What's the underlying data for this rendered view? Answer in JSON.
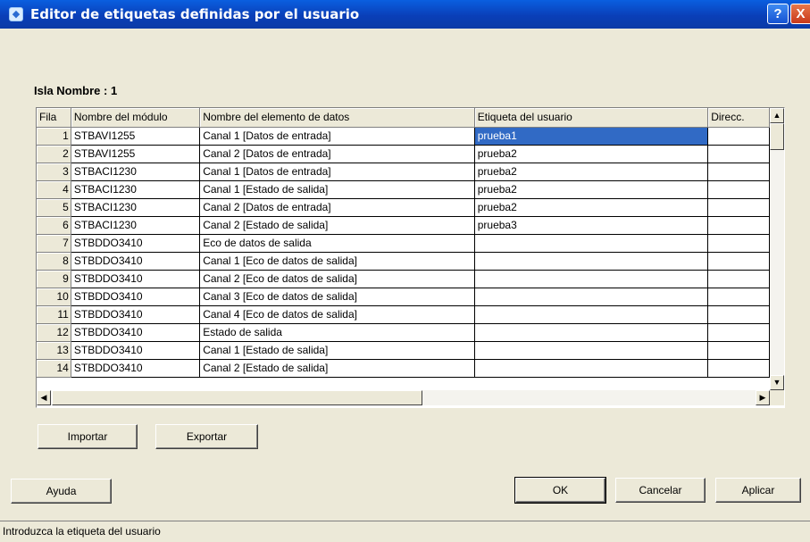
{
  "window": {
    "title": "Editor de etiquetas definidas por el usuario",
    "help_glyph": "?",
    "close_glyph": "X"
  },
  "island": {
    "label": "Isla Nombre : ",
    "value": "1"
  },
  "grid": {
    "columns": [
      "Fila",
      "Nombre del módulo",
      "Nombre del elemento de datos",
      "Etiqueta del usuario",
      "Direcc."
    ],
    "rows": [
      {
        "num": "1",
        "module": "STBAVI1255",
        "element": "Canal 1 [Datos de entrada]",
        "label": "prueba1",
        "addr": ""
      },
      {
        "num": "2",
        "module": "STBAVI1255",
        "element": "Canal 2 [Datos de entrada]",
        "label": "prueba2",
        "addr": ""
      },
      {
        "num": "3",
        "module": "STBACI1230",
        "element": "Canal 1 [Datos de entrada]",
        "label": "prueba2",
        "addr": ""
      },
      {
        "num": "4",
        "module": "STBACI1230",
        "element": "Canal 1 [Estado de salida]",
        "label": "prueba2",
        "addr": ""
      },
      {
        "num": "5",
        "module": "STBACI1230",
        "element": "Canal 2 [Datos de entrada]",
        "label": "prueba2",
        "addr": ""
      },
      {
        "num": "6",
        "module": "STBACI1230",
        "element": "Canal 2 [Estado de salida]",
        "label": "prueba3",
        "addr": ""
      },
      {
        "num": "7",
        "module": "STBDDO3410",
        "element": "Eco de datos de salida",
        "label": "",
        "addr": ""
      },
      {
        "num": "8",
        "module": "STBDDO3410",
        "element": "Canal 1 [Eco de datos de salida]",
        "label": "",
        "addr": ""
      },
      {
        "num": "9",
        "module": "STBDDO3410",
        "element": "Canal 2 [Eco de datos de salida]",
        "label": "",
        "addr": ""
      },
      {
        "num": "10",
        "module": "STBDDO3410",
        "element": "Canal 3 [Eco de datos de salida]",
        "label": "",
        "addr": ""
      },
      {
        "num": "11",
        "module": "STBDDO3410",
        "element": "Canal 4 [Eco de datos de salida]",
        "label": "",
        "addr": ""
      },
      {
        "num": "12",
        "module": "STBDDO3410",
        "element": "Estado de salida",
        "label": "",
        "addr": ""
      },
      {
        "num": "13",
        "module": "STBDDO3410",
        "element": "Canal 1 [Estado de salida]",
        "label": "",
        "addr": ""
      },
      {
        "num": "14",
        "module": "STBDDO3410",
        "element": "Canal 2 [Estado de salida]",
        "label": "",
        "addr": ""
      }
    ],
    "selected_row": 0
  },
  "buttons": {
    "import": "Importar",
    "export": "Exportar",
    "help": "Ayuda",
    "ok": "OK",
    "cancel": "Cancelar",
    "apply": "Aplicar"
  },
  "status": {
    "text": "Introduzca la etiqueta del usuario"
  },
  "colors": {
    "titlebar": "#0a4fd0",
    "selection": "#316ac5",
    "face": "#ece9d8"
  },
  "icons": {
    "app": "label-editor-icon",
    "help": "help-icon",
    "close": "close-icon"
  }
}
